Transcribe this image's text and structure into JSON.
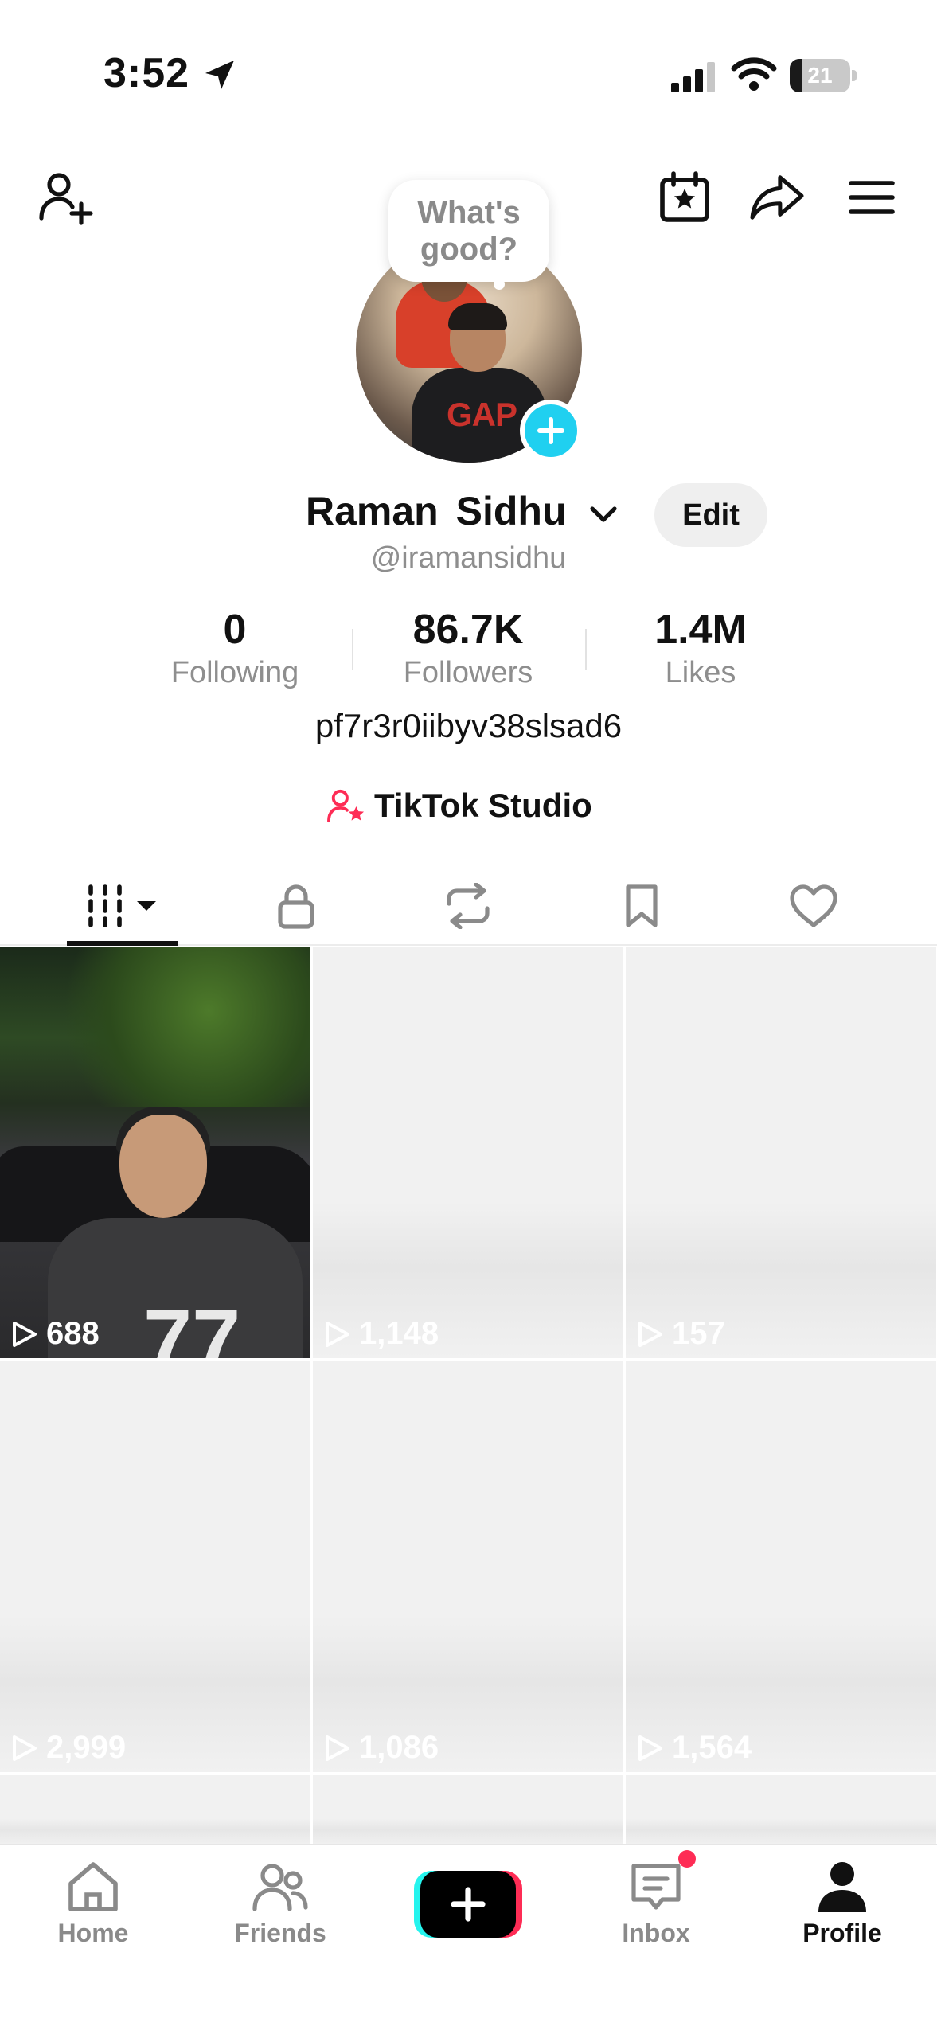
{
  "status_bar": {
    "time": "3:52",
    "battery_level": "21",
    "battery_fraction": 0.21
  },
  "header": {
    "bubble_text": "What's\ngood?"
  },
  "profile": {
    "display_name": "Raman Sidhu",
    "handle": "@iramansidhu",
    "edit_label": "Edit",
    "bio": "pf7r3r0iibyv38slsad6",
    "studio_label": "TikTok Studio",
    "avatar_text": "GAP"
  },
  "stats": {
    "following": {
      "value": "0",
      "label": "Following"
    },
    "followers": {
      "value": "86.7K",
      "label": "Followers"
    },
    "likes": {
      "value": "1.4M",
      "label": "Likes"
    }
  },
  "tabs": [
    {
      "name": "videos",
      "icon": "grid-icon",
      "active": true
    },
    {
      "name": "private",
      "icon": "lock-icon",
      "active": false
    },
    {
      "name": "reposts",
      "icon": "repost-icon",
      "active": false
    },
    {
      "name": "saved",
      "icon": "bookmark-icon",
      "active": false
    },
    {
      "name": "liked",
      "icon": "heart-icon",
      "active": false
    }
  ],
  "videos": [
    {
      "views": "688",
      "jersey_number": "77"
    },
    {
      "views": "1,148"
    },
    {
      "views": "157"
    },
    {
      "views": "2,999"
    },
    {
      "views": "1,086"
    },
    {
      "views": "1,564"
    }
  ],
  "bottom_nav": {
    "home": "Home",
    "friends": "Friends",
    "inbox": "Inbox",
    "profile": "Profile"
  },
  "colors": {
    "accent_cyan": "#20d0f0",
    "brand_pink": "#fe2c55",
    "brand_cyan": "#25f4ee"
  }
}
